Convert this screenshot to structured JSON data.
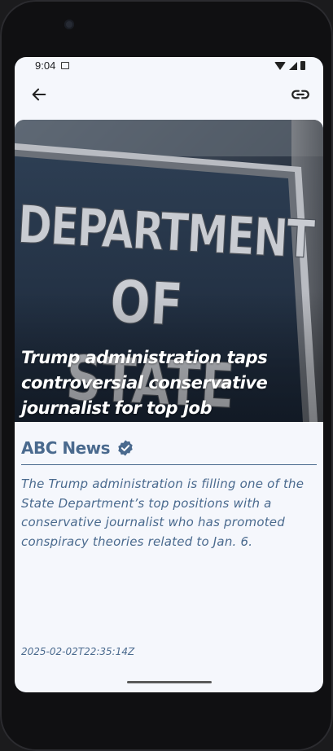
{
  "status_bar": {
    "time": "9:04",
    "icons": [
      "note-icon",
      "wifi-icon",
      "signal-icon",
      "battery-icon"
    ]
  },
  "app_bar": {
    "back_icon": "arrow-left-icon",
    "link_icon": "link-icon"
  },
  "article": {
    "image_alt_text": "DEPARTMENT OF STATE",
    "headline": "Trump administration taps controversial conservative journalist for top job",
    "source": "ABC News",
    "source_verified_icon": "verified-badge-icon",
    "description": "The Trump administration is filling one of the State Department’s top positions with a conservative journalist who has promoted conspiracy theories related to Jan. 6.",
    "published_at": "2025-02-02T22:35:14Z"
  },
  "colors": {
    "accent": "#4a6a8e",
    "screen_background": "#f5f7fc",
    "headline_text": "#ffffff"
  }
}
